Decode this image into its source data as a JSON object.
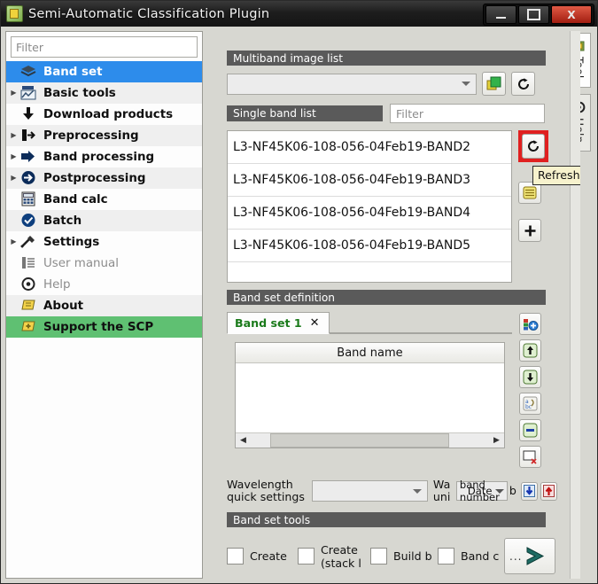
{
  "window": {
    "title": "Semi-Automatic Classification Plugin",
    "icon": "scp-logo-icon",
    "minimize_label": "—",
    "maximize_label": "□",
    "close_label": "X"
  },
  "sidebar": {
    "filter_placeholder": "Filter",
    "filter_value": "",
    "items": [
      {
        "label": "Band set",
        "icon": "layers-icon",
        "expandable": false,
        "state": "selected"
      },
      {
        "label": "Basic tools",
        "icon": "chart-tools-icon",
        "expandable": true,
        "state": "normal"
      },
      {
        "label": "Download products",
        "icon": "download-icon",
        "expandable": false,
        "state": "normal"
      },
      {
        "label": "Preprocessing",
        "icon": "arrow-in-icon",
        "expandable": true,
        "state": "normal"
      },
      {
        "label": "Band processing",
        "icon": "arrow-right-icon",
        "expandable": true,
        "state": "normal"
      },
      {
        "label": "Postprocessing",
        "icon": "arrow-out-icon",
        "expandable": true,
        "state": "normal"
      },
      {
        "label": "Band calc",
        "icon": "calculator-icon",
        "expandable": false,
        "state": "normal"
      },
      {
        "label": "Batch",
        "icon": "batch-check-icon",
        "expandable": false,
        "state": "normal"
      },
      {
        "label": "Settings",
        "icon": "wrench-icon",
        "expandable": true,
        "state": "normal"
      },
      {
        "label": "User manual",
        "icon": "manual-icon",
        "expandable": false,
        "state": "dim"
      },
      {
        "label": "Help",
        "icon": "help-icon",
        "expandable": false,
        "state": "dim"
      },
      {
        "label": "About",
        "icon": "about-icon",
        "expandable": false,
        "state": "normal"
      },
      {
        "label": "Support the SCP",
        "icon": "support-icon",
        "expandable": false,
        "state": "green"
      }
    ]
  },
  "dock": {
    "tabs": [
      {
        "label": "Tool",
        "icon": "tool-panel-icon"
      },
      {
        "label": "Help",
        "icon": "help-panel-icon"
      }
    ]
  },
  "main": {
    "multiband": {
      "header": "Multiband image list",
      "combo_value": "",
      "open_button_icon": "open-raster-icon",
      "refresh_button_icon": "refresh-icon"
    },
    "single_band": {
      "header": "Single band list",
      "filter_placeholder": "Filter",
      "filter_value": "",
      "bands": [
        "L3-NF45K06-108-056-04Feb19-BAND2",
        "L3-NF45K06-108-056-04Feb19-BAND3",
        "L3-NF45K06-108-056-04Feb19-BAND4",
        "L3-NF45K06-108-056-04Feb19-BAND5"
      ],
      "side_buttons": [
        {
          "icon": "refresh-icon",
          "highlighted": true
        },
        {
          "icon": "list-sort-icon",
          "highlighted": false
        },
        {
          "icon": "plus-icon",
          "highlighted": false
        }
      ],
      "tooltip": "Refresh list",
      "highlight_color": "#e02020"
    },
    "band_set_definition": {
      "header": "Band set definition",
      "tab_label": "Band set 1",
      "tab_close_label": "✕",
      "tab_color": "#1a7a1a",
      "table_header": "Band name",
      "rows": [],
      "side_buttons": [
        {
          "icon": "add-bandset-icon"
        },
        {
          "icon": "move-up-icon"
        },
        {
          "icon": "move-down-icon"
        },
        {
          "icon": "sort-alphabetical-icon"
        },
        {
          "icon": "remove-band-icon"
        },
        {
          "icon": "clear-bandset-icon"
        }
      ]
    },
    "wavelength": {
      "label_line1": "Wavelength",
      "label_line2": "quick settings",
      "combo_value": "",
      "unit_label_line1": "Wa",
      "unit_label_line2": "uni",
      "unit_combo_value": "band number",
      "unit_combo_overlap": "Date",
      "extra_label": "b",
      "import_button_icon": "import-down-icon",
      "export_button_icon": "export-up-icon"
    },
    "band_set_tools": {
      "header": "Band set tools",
      "checkboxes": [
        {
          "label": "Create",
          "label2": "",
          "checked": false
        },
        {
          "label": "Create",
          "label2": "(stack l",
          "checked": false
        },
        {
          "label": "Build b",
          "label2": "",
          "checked": false
        },
        {
          "label": "Band c",
          "label2": "",
          "checked": false
        }
      ],
      "run_button": {
        "dots": "...",
        "icon": "run-arrow-icon"
      }
    }
  }
}
